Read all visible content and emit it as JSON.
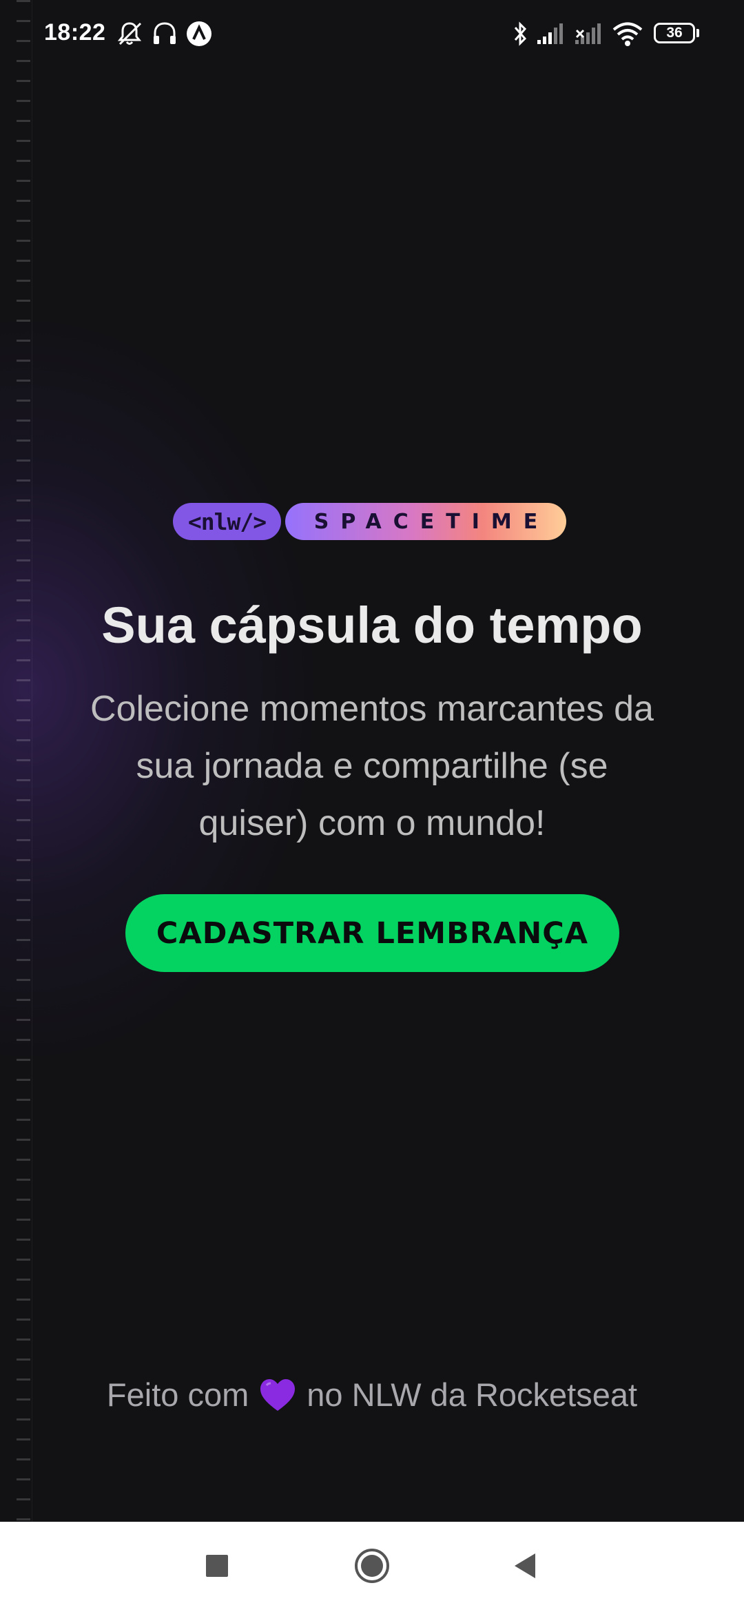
{
  "status_bar": {
    "time": "18:22",
    "battery": "36",
    "icons": [
      "notifications-off-icon",
      "headphones-icon",
      "app-badge-icon",
      "bluetooth-icon",
      "signal-icon",
      "signal-off-icon",
      "wifi-icon",
      "battery-icon"
    ]
  },
  "logo": {
    "nlw": "<nlw/>",
    "spacetime": "SPACETIME"
  },
  "main": {
    "headline": "Sua cápsula do tempo",
    "subtitle": "Colecione momentos marcantes da sua jornada e compartilhe (se quiser) com o mundo!",
    "cta_label": "CADASTRAR LEMBRANÇA"
  },
  "footer": {
    "text_before": "Feito com",
    "text_after": "no NLW da Rocketseat"
  },
  "nav_bar": {
    "buttons": [
      "recents-button",
      "home-button",
      "back-button"
    ]
  },
  "colors": {
    "background": "#121215",
    "accent_green": "#04d361",
    "purple": "#8257e5",
    "heart": "#8a2be2"
  }
}
